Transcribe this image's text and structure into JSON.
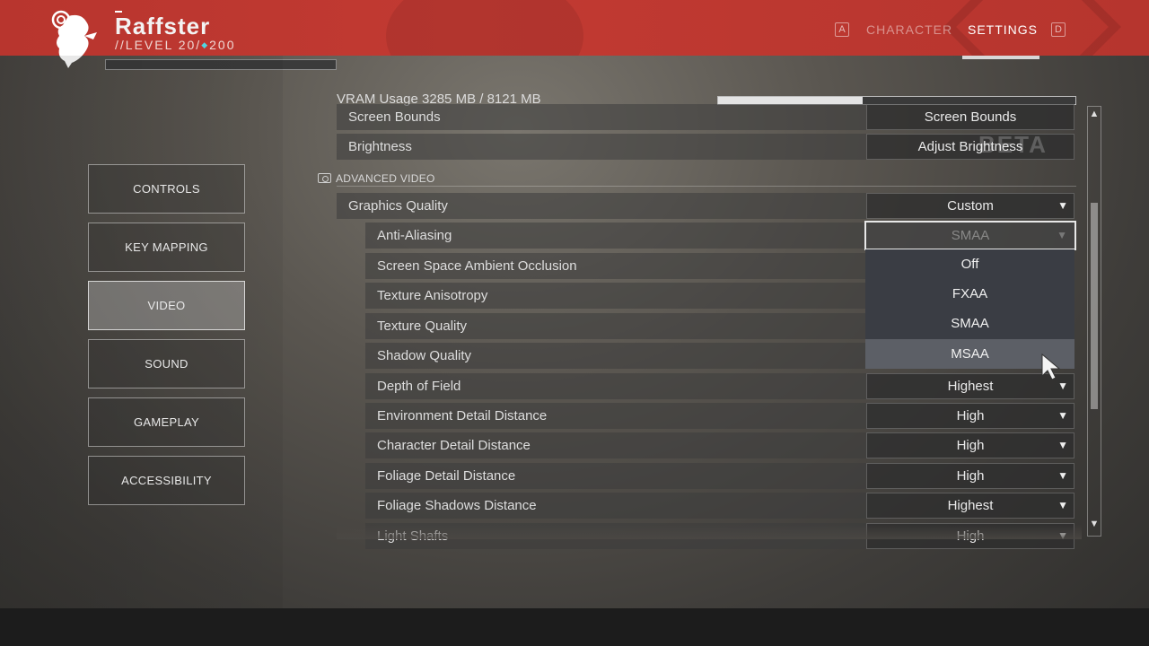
{
  "header": {
    "player_name": "Raffster",
    "level_prefix": "//LEVEL 20/",
    "level_max": "200",
    "nav_key_left": "A",
    "nav_key_right": "D",
    "tabs": [
      {
        "label": "CHARACTER"
      },
      {
        "label": "SETTINGS"
      }
    ]
  },
  "sidebar": {
    "items": [
      {
        "label": "CONTROLS"
      },
      {
        "label": "KEY MAPPING"
      },
      {
        "label": "VIDEO"
      },
      {
        "label": "SOUND"
      },
      {
        "label": "GAMEPLAY"
      },
      {
        "label": "ACCESSIBILITY"
      }
    ],
    "active": "VIDEO"
  },
  "vram": {
    "label": "VRAM Usage 3285 MB / 8121 MB",
    "used_fraction": 0.4045
  },
  "basic_rows": [
    {
      "label": "Screen Bounds",
      "value": "Screen Bounds"
    },
    {
      "label": "Brightness",
      "value": "Adjust Brightness"
    }
  ],
  "watermark": "BETA",
  "advanced": {
    "section_title": "ADVANCED VIDEO",
    "graphics_quality": {
      "label": "Graphics Quality",
      "value": "Custom"
    },
    "anti_aliasing": {
      "label": "Anti-Aliasing",
      "value": "SMAA",
      "options": [
        "Off",
        "FXAA",
        "SMAA",
        "MSAA"
      ],
      "hovered": "MSAA"
    },
    "rows": [
      {
        "label": "Screen Space Ambient Occlusion",
        "value": ""
      },
      {
        "label": "Texture Anisotropy",
        "value": ""
      },
      {
        "label": "Texture Quality",
        "value": ""
      },
      {
        "label": "Shadow Quality",
        "value": ""
      },
      {
        "label": "Depth of Field",
        "value": "Highest"
      },
      {
        "label": "Environment Detail Distance",
        "value": "High"
      },
      {
        "label": "Character Detail Distance",
        "value": "High"
      },
      {
        "label": "Foliage Detail Distance",
        "value": "High"
      },
      {
        "label": "Foliage Shadows Distance",
        "value": "Highest"
      },
      {
        "label": "Light Shafts",
        "value": "High"
      }
    ]
  },
  "icons": {
    "dropdown_arrow": "▼",
    "scroll_up": "▲",
    "scroll_down": "▼"
  }
}
